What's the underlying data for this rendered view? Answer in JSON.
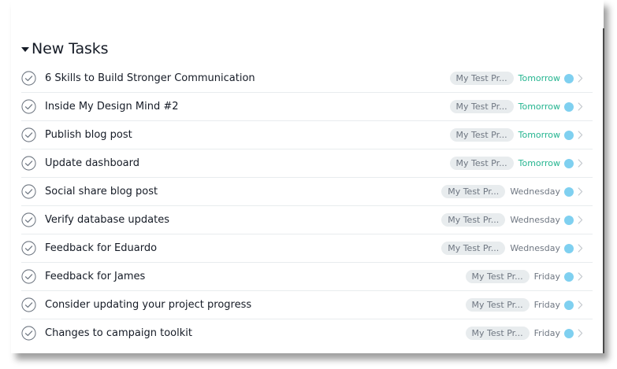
{
  "section": {
    "title": "New Tasks"
  },
  "colors": {
    "tomorrow": "#25b590",
    "weekday": "#6f7782",
    "dot": "#7fd0f0"
  },
  "tasks": [
    {
      "name": "6 Skills to Build Stronger Communication",
      "project": "My Test Pr...",
      "due": "Tomorrow",
      "due_type": "tomorrow"
    },
    {
      "name": "Inside My Design Mind #2",
      "project": "My Test Pr...",
      "due": "Tomorrow",
      "due_type": "tomorrow"
    },
    {
      "name": "Publish blog post",
      "project": "My Test Pr...",
      "due": "Tomorrow",
      "due_type": "tomorrow"
    },
    {
      "name": "Update dashboard",
      "project": "My Test Pr...",
      "due": "Tomorrow",
      "due_type": "tomorrow"
    },
    {
      "name": "Social share blog post",
      "project": "My Test Pr...",
      "due": "Wednesday",
      "due_type": "weekday"
    },
    {
      "name": "Verify database updates",
      "project": "My Test Pr...",
      "due": "Wednesday",
      "due_type": "weekday"
    },
    {
      "name": "Feedback for Eduardo",
      "project": "My Test Pr...",
      "due": "Wednesday",
      "due_type": "weekday"
    },
    {
      "name": "Feedback for James",
      "project": "My Test Pr...",
      "due": "Friday",
      "due_type": "weekday"
    },
    {
      "name": "Consider updating your project progress",
      "project": "My Test Pr...",
      "due": "Friday",
      "due_type": "weekday"
    },
    {
      "name": "Changes to campaign toolkit",
      "project": "My Test Pr...",
      "due": "Friday",
      "due_type": "weekday"
    }
  ]
}
